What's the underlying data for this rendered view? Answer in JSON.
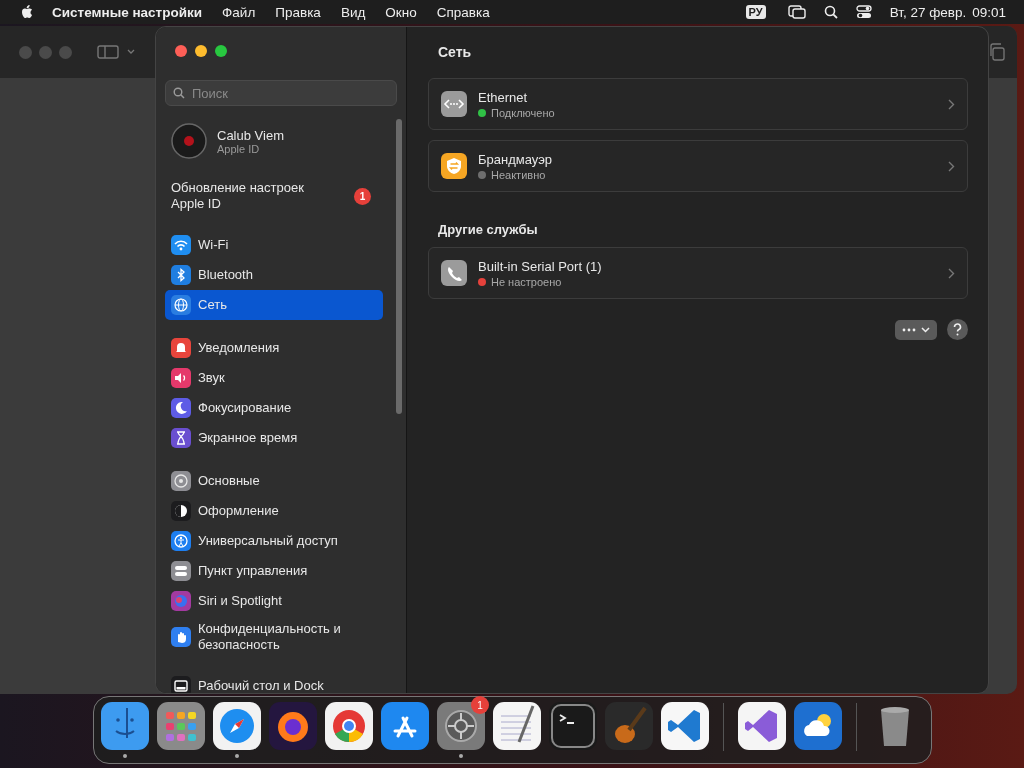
{
  "menu_bar": {
    "items": [
      {
        "label": "Системные настройки",
        "kind": "app"
      },
      {
        "label": "Файл",
        "kind": "menu"
      },
      {
        "label": "Правка",
        "kind": "menu"
      },
      {
        "label": "Вид",
        "kind": "menu"
      },
      {
        "label": "Окно",
        "kind": "menu"
      },
      {
        "label": "Справка",
        "kind": "menu"
      }
    ],
    "input_source": "РУ",
    "date": "Вт, 27 февр.",
    "time": "09:01"
  },
  "window": {
    "search": {
      "placeholder": "Поиск"
    },
    "account": {
      "name": "Calub Viem",
      "subtitle": "Apple ID"
    },
    "notice": {
      "text": "Обновление настроек Apple ID",
      "badge": "1"
    },
    "sidebar": {
      "groups": [
        {
          "items": [
            {
              "label": "Wi-Fi",
              "color": "#1f8ef1",
              "selected": false
            },
            {
              "label": "Bluetooth",
              "color": "#1f7ee0",
              "selected": false
            },
            {
              "label": "Сеть",
              "color": "#2a7de1",
              "selected": true
            }
          ]
        },
        {
          "items": [
            {
              "label": "Уведомления",
              "color": "#e8453c",
              "selected": false
            },
            {
              "label": "Звук",
              "color": "#e5396b",
              "selected": false
            },
            {
              "label": "Фокусирование",
              "color": "#5e5ce6",
              "selected": false
            },
            {
              "label": "Экранное время",
              "color": "#6a4fd0",
              "selected": false
            }
          ]
        },
        {
          "items": [
            {
              "label": "Основные",
              "color": "#8e8e93",
              "selected": false
            },
            {
              "label": "Оформление",
              "color": "#1c1c1e",
              "selected": false
            },
            {
              "label": "Универсальный доступ",
              "color": "#1e7ff0",
              "selected": false
            },
            {
              "label": "Пункт управления",
              "color": "#8e8e93",
              "selected": false
            },
            {
              "label": "Siri и Spotlight",
              "color": "#a33aa0",
              "selected": false
            },
            {
              "label": "Конфиденциальность и безопасность",
              "color": "#2f7ff0",
              "selected": false
            }
          ]
        },
        {
          "items": [
            {
              "label": "Рабочий стол и Dock",
              "color": "#1c1c1e",
              "selected": false
            }
          ]
        }
      ]
    },
    "content": {
      "title": "Сеть",
      "sections": [
        {
          "cards": [
            {
              "name": "Ethernet",
              "status": "Подключено",
              "color": "#30c146"
            },
            {
              "name": "Брандмауэр",
              "status": "Неактивно",
              "color": "#6e6e6e"
            }
          ]
        },
        {
          "heading": "Другие службы",
          "cards": [
            {
              "name": "Built-in Serial Port (1)",
              "status": "Не настроено",
              "color": "#e5413b"
            }
          ]
        }
      ]
    }
  },
  "dock": {
    "items": [
      {
        "kind": "app",
        "running": true
      },
      {
        "kind": "app",
        "running": false
      },
      {
        "kind": "app",
        "running": true
      },
      {
        "kind": "app",
        "running": false
      },
      {
        "kind": "app",
        "running": false
      },
      {
        "kind": "app",
        "running": false
      },
      {
        "kind": "app",
        "running": true,
        "badge": "1"
      },
      {
        "kind": "app",
        "running": false
      },
      {
        "kind": "app",
        "running": false
      },
      {
        "kind": "app",
        "running": false
      },
      {
        "kind": "app",
        "running": false
      },
      {
        "kind": "separator"
      },
      {
        "kind": "app",
        "running": false
      },
      {
        "kind": "app",
        "running": false
      },
      {
        "kind": "separator"
      },
      {
        "kind": "app",
        "running": false
      }
    ]
  }
}
